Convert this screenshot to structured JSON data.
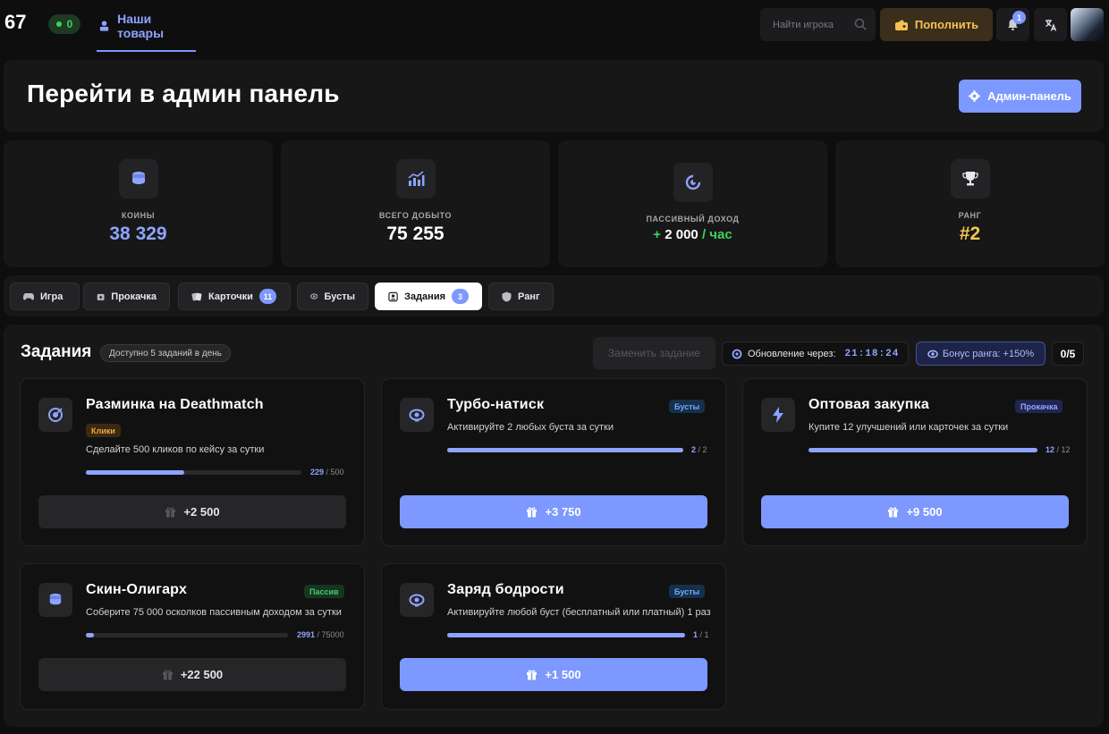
{
  "topbar": {
    "logo_text": "67",
    "online_count": "0",
    "nav_tab_label": "Наши товары",
    "search_placeholder": "Найти игрока",
    "topup_label": "Пополнить",
    "notifications_count": "1"
  },
  "admin": {
    "title": "Перейти в админ панель",
    "button_label": "Админ-панель"
  },
  "stats": [
    {
      "label": "КОИНЫ",
      "value": "38 329",
      "color": "#8ea3ff",
      "icon": "coins-icon"
    },
    {
      "label": "ВСЕГО ДОБЫТО",
      "value": "75 255",
      "color": "#ffffff",
      "icon": "chart-icon"
    },
    {
      "label": "ПАССИВНЫЙ ДОХОД",
      "value_prefix": "+",
      "value": "2 000",
      "value_suffix": "/ час",
      "color": "#3fd15a",
      "icon": "income-icon"
    },
    {
      "label": "РАНГ",
      "value": "#2",
      "color": "#f5c84a",
      "icon": "trophy-icon"
    }
  ],
  "tabs": [
    {
      "label": "Игра",
      "icon": "gamepad-icon"
    },
    {
      "label": "Прокачка",
      "icon": "upgrade-icon"
    },
    {
      "label": "Карточки",
      "icon": "cards-icon",
      "count": "11"
    },
    {
      "label": "Бусты",
      "icon": "boost-icon"
    },
    {
      "label": "Задания",
      "icon": "tasks-icon",
      "count": "3",
      "active": true
    },
    {
      "label": "Ранг",
      "icon": "rank-icon"
    }
  ],
  "tasks_section": {
    "title": "Задания",
    "daily_limit": "Доступно 5 заданий в день",
    "replace_label": "Заменить задание",
    "refresh_label": "Обновление через:",
    "refresh_timer": "21:18:24",
    "bonus_label": "Бонус ранга: +150%",
    "completed_count": "0/5"
  },
  "tasks": [
    {
      "title": "Разминка на Deathmatch",
      "tag": "Клики",
      "tag_color": "#f0a93a",
      "description": "Сделайте 500 кликов по кейсу за сутки",
      "progress_current": "229",
      "progress_total": "/ 500",
      "progress_ratio": 0.458,
      "reward": "+2 500",
      "ready": false,
      "icon": "target-icon"
    },
    {
      "title": "Турбо-натиск",
      "tag": "Бусты",
      "tag_color": "#6fa8ff",
      "description": "Активируйте 2 любых буста за сутки",
      "progress_current": "2",
      "progress_total": "/ 2",
      "progress_ratio": 1.0,
      "reward": "+3 750",
      "ready": true,
      "icon": "boost-icon"
    },
    {
      "title": "Оптовая закупка",
      "tag": "Прокачка",
      "tag_color": "#9aa6ff",
      "description": "Купите 12 улучшений или карточек за сутки",
      "progress_current": "12",
      "progress_total": "/ 12",
      "progress_ratio": 1.0,
      "reward": "+9 500",
      "ready": true,
      "icon": "lightning-icon"
    },
    {
      "title": "Скин-Олигарх",
      "tag": "Пассив",
      "tag_color": "#43c968",
      "description": "Соберите 75 000 осколков пассивным доходом за сутки",
      "progress_current": "2991",
      "progress_total": "/ 75000",
      "progress_ratio": 0.04,
      "reward": "+22 500",
      "ready": false,
      "icon": "coins-icon"
    },
    {
      "title": "Заряд бодрости",
      "tag": "Бусты",
      "tag_color": "#6fa8ff",
      "description": "Активируйте любой буст (бесплатный или платный) 1 раз",
      "progress_current": "1",
      "progress_total": "/ 1",
      "progress_ratio": 1.0,
      "reward": "+1 500",
      "ready": true,
      "icon": "boost-icon"
    }
  ]
}
